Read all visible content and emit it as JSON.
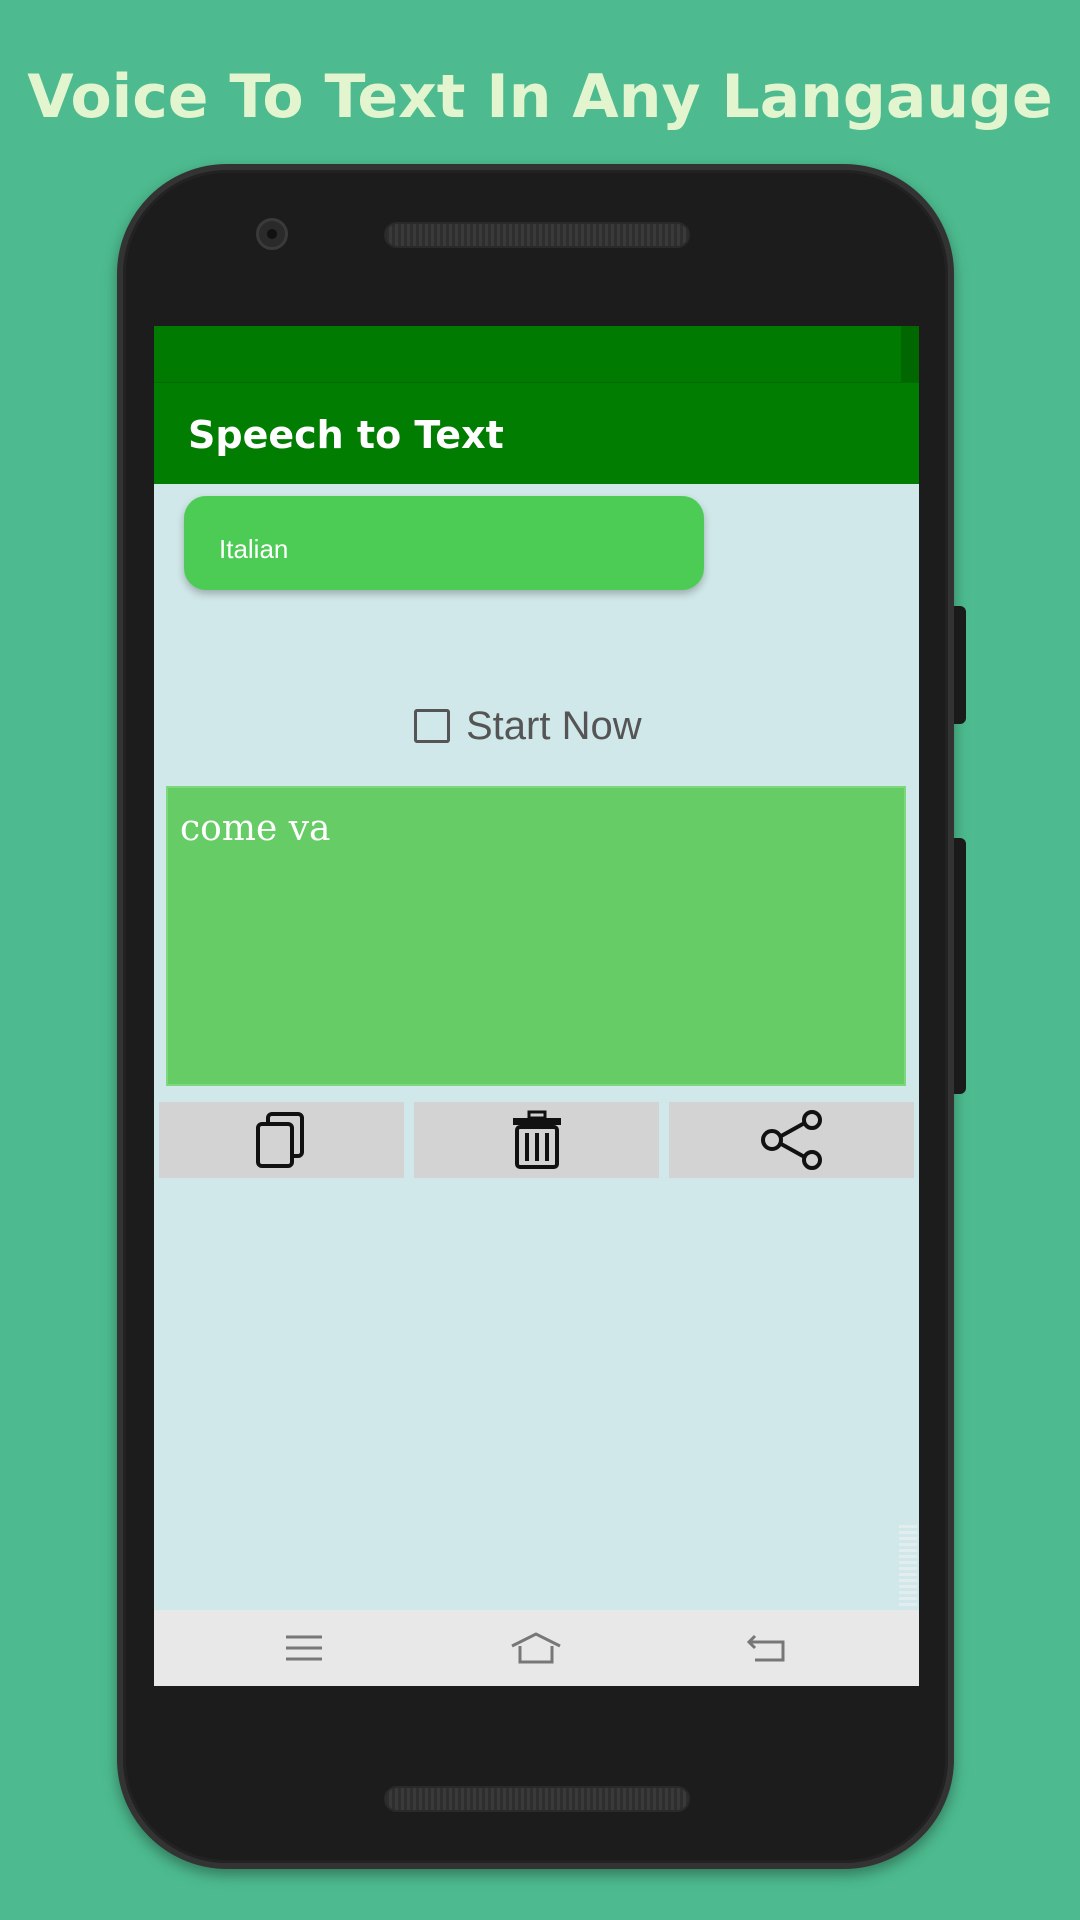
{
  "promo": {
    "headline": "Voice To Text In Any Langauge"
  },
  "app": {
    "title": "Speech to Text",
    "language": {
      "selected": "Italian"
    },
    "start": {
      "label": "Start Now",
      "checked": false
    },
    "transcript": {
      "value": "come va"
    },
    "actions": {
      "copy": {
        "icon": "copy-icon"
      },
      "delete": {
        "icon": "trash-icon"
      },
      "share": {
        "icon": "share-icon"
      }
    }
  },
  "system_nav": {
    "menu": {
      "icon": "menu-icon"
    },
    "home": {
      "icon": "home-icon"
    },
    "back": {
      "icon": "back-icon"
    }
  },
  "colors": {
    "background": "#4dbb8f",
    "headline": "#e3f5cf",
    "app_bar": "#017d01",
    "status_bar": "#017a01",
    "language_button": "#4ccc55",
    "transcript_area": "#66cc66",
    "screen_bg": "#d0e8e9",
    "action_button": "#d3d3d3"
  }
}
